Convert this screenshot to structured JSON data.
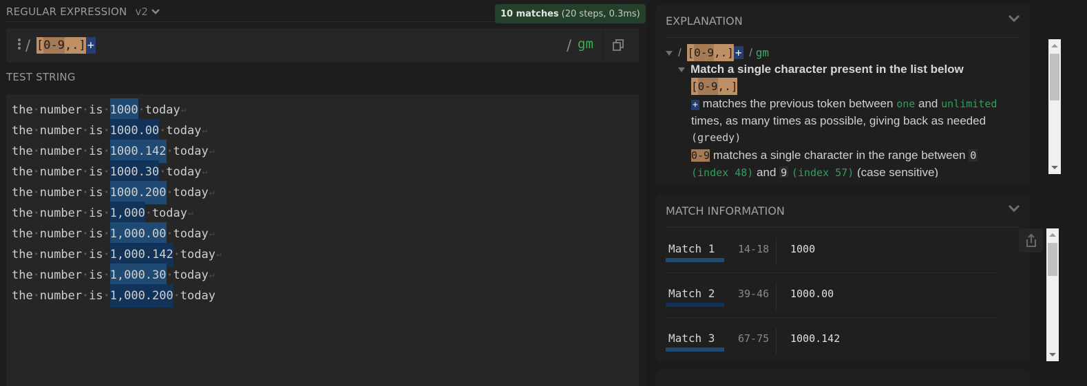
{
  "regex": {
    "section_title": "REGULAR EXPRESSION",
    "flavor": "v2",
    "status": {
      "count_label": "10 matches",
      "detail": "(20 steps, 0.3ms)",
      "color": "#23402b"
    },
    "delimiter_open": "/",
    "delimiter_close": "/",
    "pattern": {
      "class_open": "[",
      "range": "0-9",
      "chars": ",.",
      "class_close": "]",
      "quantifier": "+"
    },
    "flags": "gm",
    "menu_icon": "vertical-dots-icon",
    "copy_icon": "copy-icon"
  },
  "test_string": {
    "section_title": "TEST STRING",
    "lines": [
      {
        "words": [
          "the",
          "number",
          "is"
        ],
        "match": "1000",
        "after": "today",
        "eol": true
      },
      {
        "words": [
          "the",
          "number",
          "is"
        ],
        "match": "1000.00",
        "after": "today",
        "eol": true
      },
      {
        "words": [
          "the",
          "number",
          "is"
        ],
        "match": "1000.142",
        "after": "today",
        "eol": true
      },
      {
        "words": [
          "the",
          "number",
          "is"
        ],
        "match": "1000.30",
        "after": "today",
        "eol": true
      },
      {
        "words": [
          "the",
          "number",
          "is"
        ],
        "match": "1000.200",
        "after": "today",
        "eol": true
      },
      {
        "words": [
          "the",
          "number",
          "is"
        ],
        "match": "1,000",
        "after": "today",
        "eol": true
      },
      {
        "words": [
          "the",
          "number",
          "is"
        ],
        "match": "1,000.00",
        "after": "today",
        "eol": true
      },
      {
        "words": [
          "the",
          "number",
          "is"
        ],
        "match": "1,000.142",
        "after": "today",
        "eol": true
      },
      {
        "words": [
          "the",
          "number",
          "is"
        ],
        "match": "1,000.30",
        "after": "today",
        "eol": true
      },
      {
        "words": [
          "the",
          "number",
          "is"
        ],
        "match": "1,000.200",
        "after": "today",
        "eol": false
      }
    ],
    "highlight_colors": [
      "#1f4a73",
      "#123359"
    ]
  },
  "explanation": {
    "title": "EXPLANATION",
    "root": {
      "open": "/",
      "close": "/",
      "flags": "gm"
    },
    "node_title": "Match a single character present in the list below",
    "node_token": "[0-9,.]",
    "quant": {
      "token": "+",
      "t1": "matches the previous token between",
      "one": "one",
      "and": "and",
      "unlimited": "unlimited",
      "t2": "times, as many times as possible, giving back as needed",
      "greedy": "(greedy)"
    },
    "range": {
      "token": "0-9",
      "t1": "matches a single character in the range between",
      "from": "0",
      "from_index": "(index 48)",
      "and": "and",
      "to": "9",
      "to_index": "(index 57)",
      "case": "(case sensitive)"
    }
  },
  "match_info": {
    "title": "MATCH INFORMATION",
    "export_icon": "share-export-icon",
    "matches": [
      {
        "label": "Match 1",
        "range": "14-18",
        "value": "1000"
      },
      {
        "label": "Match 2",
        "range": "39-46",
        "value": "1000.00"
      },
      {
        "label": "Match 3",
        "range": "67-75",
        "value": "1000.142"
      }
    ]
  }
}
